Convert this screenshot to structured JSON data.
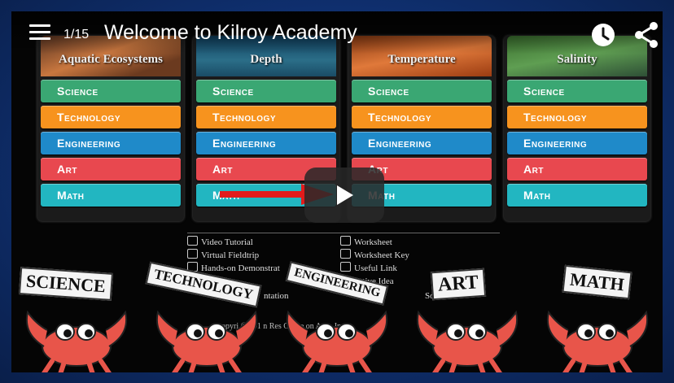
{
  "player": {
    "counter": "1/15",
    "title": "Welcome to Kilroy Academy",
    "icons": [
      "menu-icon",
      "clock-icon",
      "share-icon",
      "play-icon"
    ]
  },
  "columns": [
    {
      "heading": "Aquatic Ecosystems"
    },
    {
      "heading": "Depth"
    },
    {
      "heading": "Temperature"
    },
    {
      "heading": "Salinity"
    }
  ],
  "stem_buttons": [
    "Science",
    "Technology",
    "Engineering",
    "Art",
    "Math"
  ],
  "key": {
    "left": [
      "Video Tutorial",
      "Virtual Fieldtrip",
      "Hands-on Demonstrat"
    ],
    "right": [
      "Worksheet",
      "Worksheet Key",
      "Useful Link",
      "reative Idea",
      "Solution"
    ],
    "fragment": "ntation"
  },
  "copyright": "opyri  © 201    n Res     Conse    on As      a, Inc.",
  "signs": [
    "SCIENCE",
    "TECHNOLOGY",
    "ENGINEERING",
    "ART",
    "MATH"
  ],
  "colors": {
    "science": "#3aa773",
    "technology": "#f7931e",
    "engineering": "#1f8ac9",
    "art": "#e8484f",
    "math": "#22b6c1",
    "crab": "#e8554a",
    "arrow": "#e21b1b"
  }
}
